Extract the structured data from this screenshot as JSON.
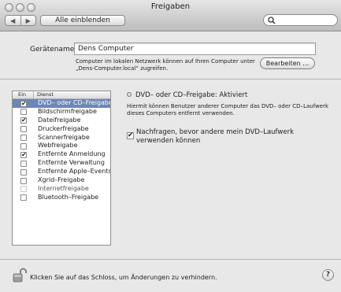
{
  "window": {
    "title": "Freigaben"
  },
  "toolbar": {
    "back_icon": "left-arrow-icon",
    "forward_icon": "right-arrow-icon",
    "show_all_label": "Alle einblenden",
    "search_icon": "magnifier-icon",
    "search_value": ""
  },
  "computer_name": {
    "label": "Gerätename:",
    "value": "Dens Computer",
    "help": "Computer im lokalen Netzwerk können auf Ihren Computer unter „Dens-Computer.local“ zugreifen.",
    "edit_label": "Bearbeiten …"
  },
  "services": {
    "col_on": "Ein",
    "col_service": "Dienst",
    "items": [
      {
        "label": "DVD– oder CD–Freigabe",
        "checked": true,
        "selected": true,
        "disabled": false
      },
      {
        "label": "Bildschirmfreigabe",
        "checked": false,
        "selected": false,
        "disabled": false
      },
      {
        "label": "Dateifreigabe",
        "checked": true,
        "selected": false,
        "disabled": false
      },
      {
        "label": "Druckerfreigabe",
        "checked": false,
        "selected": false,
        "disabled": false
      },
      {
        "label": "Scannerfreigabe",
        "checked": false,
        "selected": false,
        "disabled": false
      },
      {
        "label": "Webfreigabe",
        "checked": false,
        "selected": false,
        "disabled": false
      },
      {
        "label": "Entfernte Anmeldung",
        "checked": true,
        "selected": false,
        "disabled": false
      },
      {
        "label": "Entfernte Verwaltung",
        "checked": false,
        "selected": false,
        "disabled": false
      },
      {
        "label": "Entfernte Apple–Events",
        "checked": false,
        "selected": false,
        "disabled": false
      },
      {
        "label": "Xgrid–Freigabe",
        "checked": false,
        "selected": false,
        "disabled": false
      },
      {
        "label": "Internetfreigabe",
        "checked": false,
        "selected": false,
        "disabled": true
      },
      {
        "label": "Bluetooth–Freigabe",
        "checked": false,
        "selected": false,
        "disabled": false
      }
    ]
  },
  "detail": {
    "status": "DVD– oder CD–Freigabe: Aktiviert",
    "description": "Hiermit können Benutzer anderer Computer das DVD– oder CD–Laufwerk dieses Computers entfernt verwenden.",
    "ask_checkbox_checked": true,
    "ask_label": "Nachfragen, bevor andere mein DVD–Laufwerk verwenden können"
  },
  "footer": {
    "lock_icon": "open-lock-icon",
    "lock_text": "Klicken Sie auf das Schloss, um Änderungen zu verhindern.",
    "help_label": "?"
  },
  "colors": {
    "selection": "#6c86b6",
    "background": "#e8e8e8"
  }
}
